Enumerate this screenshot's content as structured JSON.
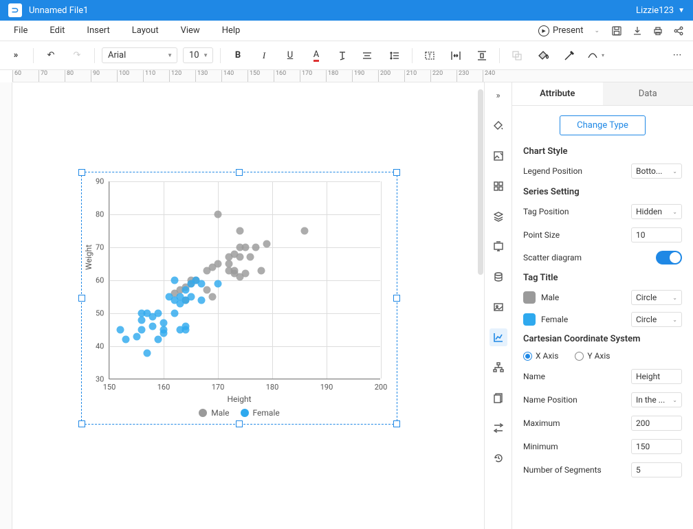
{
  "title_bar": {
    "file_name": "Unnamed File1",
    "user": "Lizzie123"
  },
  "menus": {
    "file": "File",
    "edit": "Edit",
    "insert": "Insert",
    "layout": "Layout",
    "view": "View",
    "help": "Help",
    "present": "Present"
  },
  "toolbar": {
    "font": "Arial",
    "size": "10"
  },
  "ruler": [
    "60",
    "70",
    "80",
    "90",
    "100",
    "110",
    "120",
    "130",
    "140",
    "150",
    "160",
    "170",
    "180",
    "190",
    "200",
    "210",
    "220",
    "230",
    "240"
  ],
  "chart_data": {
    "type": "scatter",
    "xlabel": "Height",
    "ylabel": "Weight",
    "xlim": [
      150,
      200
    ],
    "ylim": [
      30,
      90
    ],
    "x_ticks": [
      150,
      160,
      170,
      180,
      190,
      200
    ],
    "y_ticks": [
      30,
      40,
      50,
      60,
      70,
      80,
      90
    ],
    "series": [
      {
        "name": "Male",
        "color": "#9a9a9a",
        "points": [
          [
            162,
            56
          ],
          [
            163,
            57
          ],
          [
            164,
            54
          ],
          [
            164,
            58
          ],
          [
            165,
            59
          ],
          [
            165,
            60
          ],
          [
            166,
            60
          ],
          [
            168,
            57
          ],
          [
            168,
            63
          ],
          [
            169,
            55
          ],
          [
            169,
            64
          ],
          [
            170,
            65
          ],
          [
            170,
            80
          ],
          [
            172,
            63
          ],
          [
            172,
            65
          ],
          [
            172,
            67
          ],
          [
            173,
            62
          ],
          [
            173,
            68
          ],
          [
            173,
            63
          ],
          [
            174,
            61
          ],
          [
            174,
            67
          ],
          [
            174,
            70
          ],
          [
            174,
            75
          ],
          [
            175,
            62
          ],
          [
            175,
            70
          ],
          [
            176,
            67
          ],
          [
            177,
            70
          ],
          [
            178,
            63
          ],
          [
            179,
            71
          ],
          [
            186,
            75
          ]
        ]
      },
      {
        "name": "Female",
        "color": "#2fa9ee",
        "points": [
          [
            152,
            45
          ],
          [
            153,
            42
          ],
          [
            155,
            43
          ],
          [
            156,
            48
          ],
          [
            156,
            50
          ],
          [
            156,
            45
          ],
          [
            157,
            50
          ],
          [
            157,
            38
          ],
          [
            158,
            46
          ],
          [
            158,
            49
          ],
          [
            159,
            42
          ],
          [
            159,
            50
          ],
          [
            160,
            47
          ],
          [
            160,
            45
          ],
          [
            160,
            44
          ],
          [
            161,
            55
          ],
          [
            162,
            50
          ],
          [
            162,
            54
          ],
          [
            162,
            60
          ],
          [
            163,
            55
          ],
          [
            163,
            53
          ],
          [
            163,
            45
          ],
          [
            164,
            57
          ],
          [
            164,
            54
          ],
          [
            164,
            46
          ],
          [
            164,
            45
          ],
          [
            165,
            55
          ],
          [
            165,
            59
          ],
          [
            166,
            60
          ],
          [
            167,
            59
          ],
          [
            167,
            54
          ],
          [
            170,
            59
          ]
        ]
      }
    ]
  },
  "props": {
    "tab_attribute": "Attribute",
    "tab_data": "Data",
    "change_type": "Change Type",
    "chart_style": "Chart Style",
    "legend_position": "Legend Position",
    "legend_position_val": "Botto...",
    "series_setting": "Series Setting",
    "tag_position": "Tag Position",
    "tag_position_val": "Hidden",
    "point_size": "Point Size",
    "point_size_val": "10",
    "scatter_diagram": "Scatter diagram",
    "tag_title": "Tag Title",
    "shape_circle": "Circle",
    "male": "Male",
    "female": "Female",
    "ccs": "Cartesian Coordinate System",
    "x_axis": "X Axis",
    "y_axis": "Y Axis",
    "name": "Name",
    "name_val": "Height",
    "name_position": "Name Position",
    "name_position_val": "In the ...",
    "maximum": "Maximum",
    "maximum_val": "200",
    "minimum": "Minimum",
    "minimum_val": "150",
    "num_segments": "Number of Segments",
    "num_segments_val": "5"
  }
}
